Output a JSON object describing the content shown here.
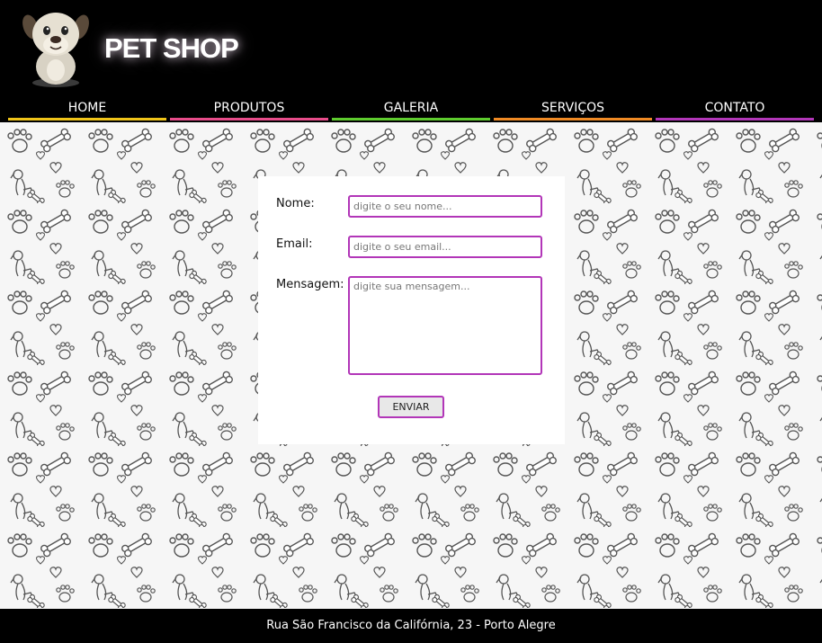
{
  "header": {
    "title": "PET SHOP",
    "logo_icon": "cartoon-dog-logo"
  },
  "nav": {
    "items": [
      {
        "label": "HOME",
        "color": "#f0c419"
      },
      {
        "label": "PRODUTOS",
        "color": "#e84c8a"
      },
      {
        "label": "GALERIA",
        "color": "#5ecb2e"
      },
      {
        "label": "SERVIÇOS",
        "color": "#f08a24"
      },
      {
        "label": "CONTATO",
        "color": "#b236b8"
      }
    ]
  },
  "form": {
    "name_label": "Nome:",
    "name_placeholder": "digite o seu nome...",
    "email_label": "Email:",
    "email_placeholder": "digite o seu email...",
    "message_label": "Mensagem:",
    "message_placeholder": "digite sua mensagem...",
    "submit_label": "ENVIAR",
    "accent_color": "#b236b8"
  },
  "background": {
    "pattern_icons": [
      "paw-print-icon",
      "bone-icon",
      "heart-icon",
      "dog-icon"
    ]
  },
  "footer": {
    "address": "Rua São Francisco da Califórnia, 23 - Porto Alegre"
  }
}
